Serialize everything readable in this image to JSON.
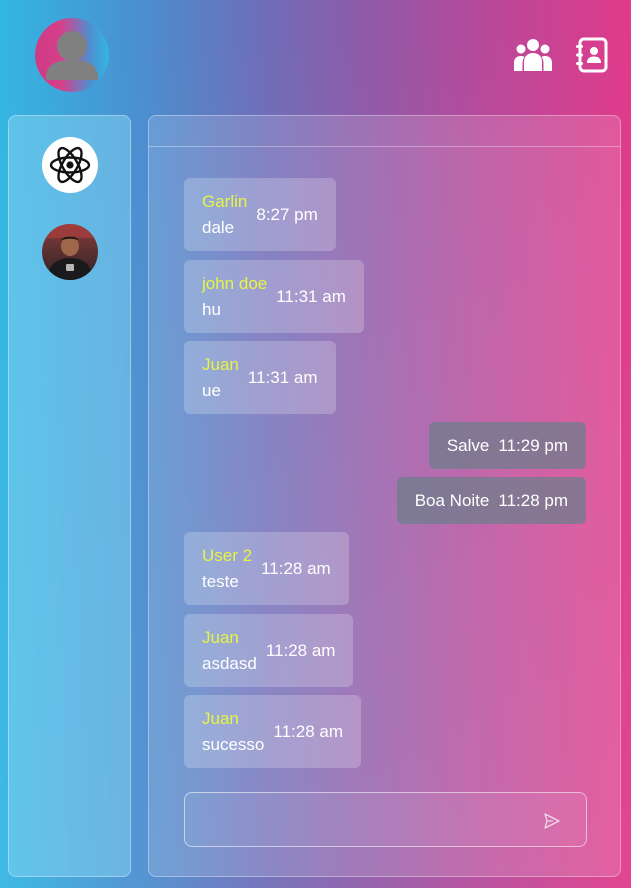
{
  "header": {
    "user_avatar": "user-silhouette-icon",
    "icons": [
      "users-group-icon",
      "contacts-book-icon"
    ]
  },
  "sidebar": {
    "chats": [
      {
        "icon": "react-logo-icon"
      },
      {
        "icon": "profile-photo"
      }
    ]
  },
  "messages": [
    {
      "direction": "in",
      "author": "Garlin",
      "text": "dale",
      "time": "8:27 pm"
    },
    {
      "direction": "in",
      "author": "john doe",
      "text": "hu",
      "time": "11:31 am"
    },
    {
      "direction": "in",
      "author": "Juan",
      "text": "ue",
      "time": "11:31 am"
    },
    {
      "direction": "out",
      "text": "Salve",
      "time": "11:29 pm"
    },
    {
      "direction": "out",
      "text": "Boa Noite",
      "time": "11:28 pm"
    },
    {
      "direction": "in",
      "author": "User 2",
      "text": "teste",
      "time": "11:28 am"
    },
    {
      "direction": "in",
      "author": "Juan",
      "text": "asdasd",
      "time": "11:28 am"
    },
    {
      "direction": "in",
      "author": "Juan",
      "text": "sucesso",
      "time": "11:28 am"
    }
  ],
  "composer": {
    "value": "",
    "placeholder": "",
    "send_icon": "send-icon"
  },
  "colors": {
    "author_name": "#e7f542",
    "outgoing_bubble": "#6e7d8c"
  }
}
